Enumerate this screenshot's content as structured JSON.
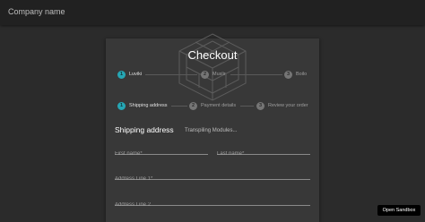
{
  "appbar": {
    "title": "Company name"
  },
  "checkout": {
    "title": "Checkout",
    "top_steps": [
      {
        "num": "1",
        "label": "Luviki",
        "active": true
      },
      {
        "num": "2",
        "label": "Muslir",
        "active": false
      },
      {
        "num": "3",
        "label": "Boilo",
        "active": false
      }
    ],
    "steps": [
      {
        "num": "1",
        "label": "Shipping address",
        "active": true
      },
      {
        "num": "2",
        "label": "Payment details",
        "active": false
      },
      {
        "num": "3",
        "label": "Review your order",
        "active": false
      }
    ]
  },
  "form": {
    "title": "Shipping address",
    "loading_text": "Transpiling Modules...",
    "fields": {
      "first_name": "First name*",
      "last_name": "Last name*",
      "address1": "Address Line 1*",
      "address2": "Address Line 2"
    }
  },
  "sandbox": {
    "label": "Open Sandbox"
  },
  "colors": {
    "accent": "#26a6b4",
    "background": "#2b2b2b",
    "appbar": "#212121",
    "paper": "#383838"
  }
}
